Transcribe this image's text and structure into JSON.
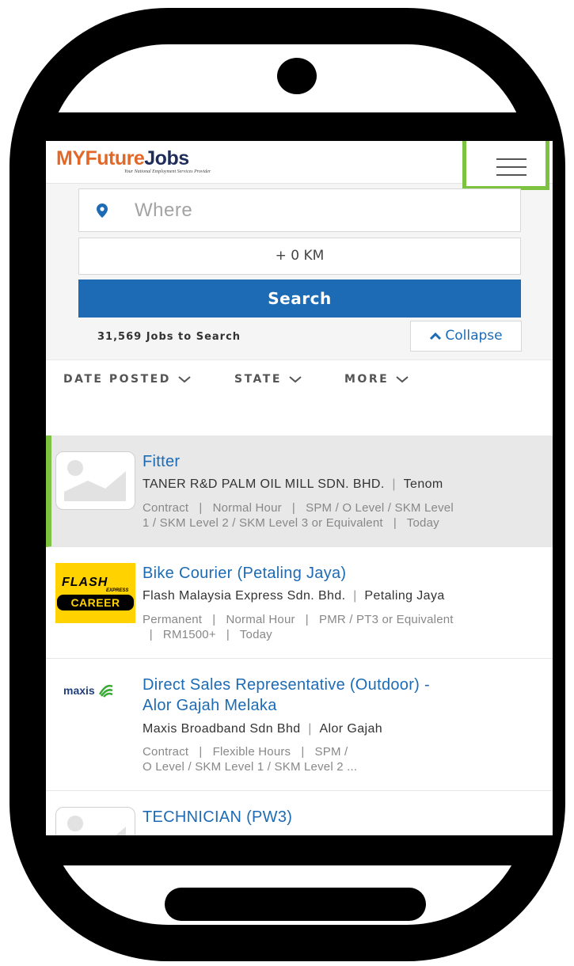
{
  "header": {
    "logo": {
      "my": "MY",
      "future": "Future",
      "jobs": "Jobs",
      "tagline": "Your National Employment Services Provider"
    },
    "menu_icon": "hamburger-menu-icon"
  },
  "search": {
    "where_placeholder": "Where",
    "location_icon": "map-pin-icon",
    "radius": "+ 0 KM",
    "search_label": "Search",
    "jobs_count": "31,569 Jobs to Search",
    "collapse_label": "Collapse"
  },
  "filters": [
    "DATE POSTED",
    "STATE",
    "MORE"
  ],
  "jobs": [
    {
      "title": "Fitter",
      "company": "TANER R&D PALM OIL MILL SDN. BHD.",
      "location": "Tenom",
      "meta_line1": "Contract   |   Normal Hour   |   SPM / O Level / SKM Level",
      "meta_line2": "1 / SKM Level 2 / SKM Level 3 or Equivalent   |   Today",
      "logo": "placeholder-image-icon"
    },
    {
      "title": "Bike Courier (Petaling Jaya)",
      "company": "Flash Malaysia Express Sdn. Bhd.",
      "location": "Petaling Jaya",
      "meta_line1": "Permanent   |   Normal Hour   |   PMR / PT3 or Equivalent",
      "meta_line2": "  |   RM1500+   |   Today",
      "logo_text_top": "FLASH",
      "logo_text_sub": "EXPRESS",
      "logo_text_bottom": "CAREER"
    },
    {
      "title_line1": "Direct Sales Representative (Outdoor) -",
      "title_line2": "Alor Gajah Melaka",
      "company": "Maxis Broadband Sdn Bhd",
      "location": "Alor Gajah",
      "meta_line1": "Contract   |   Flexible Hours   |   SPM /",
      "meta_line2": "O Level / SKM Level 1 / SKM Level 2 ...",
      "logo_text": "maxis"
    },
    {
      "title": "TECHNICIAN (PW3)",
      "logo": "placeholder-image-icon"
    }
  ],
  "colors": {
    "brand_orange": "#e2682a",
    "brand_navy": "#1f2d5a",
    "link_blue": "#1d6bb5",
    "highlight_green": "#7dc241",
    "flash_yellow": "#ffd200"
  }
}
